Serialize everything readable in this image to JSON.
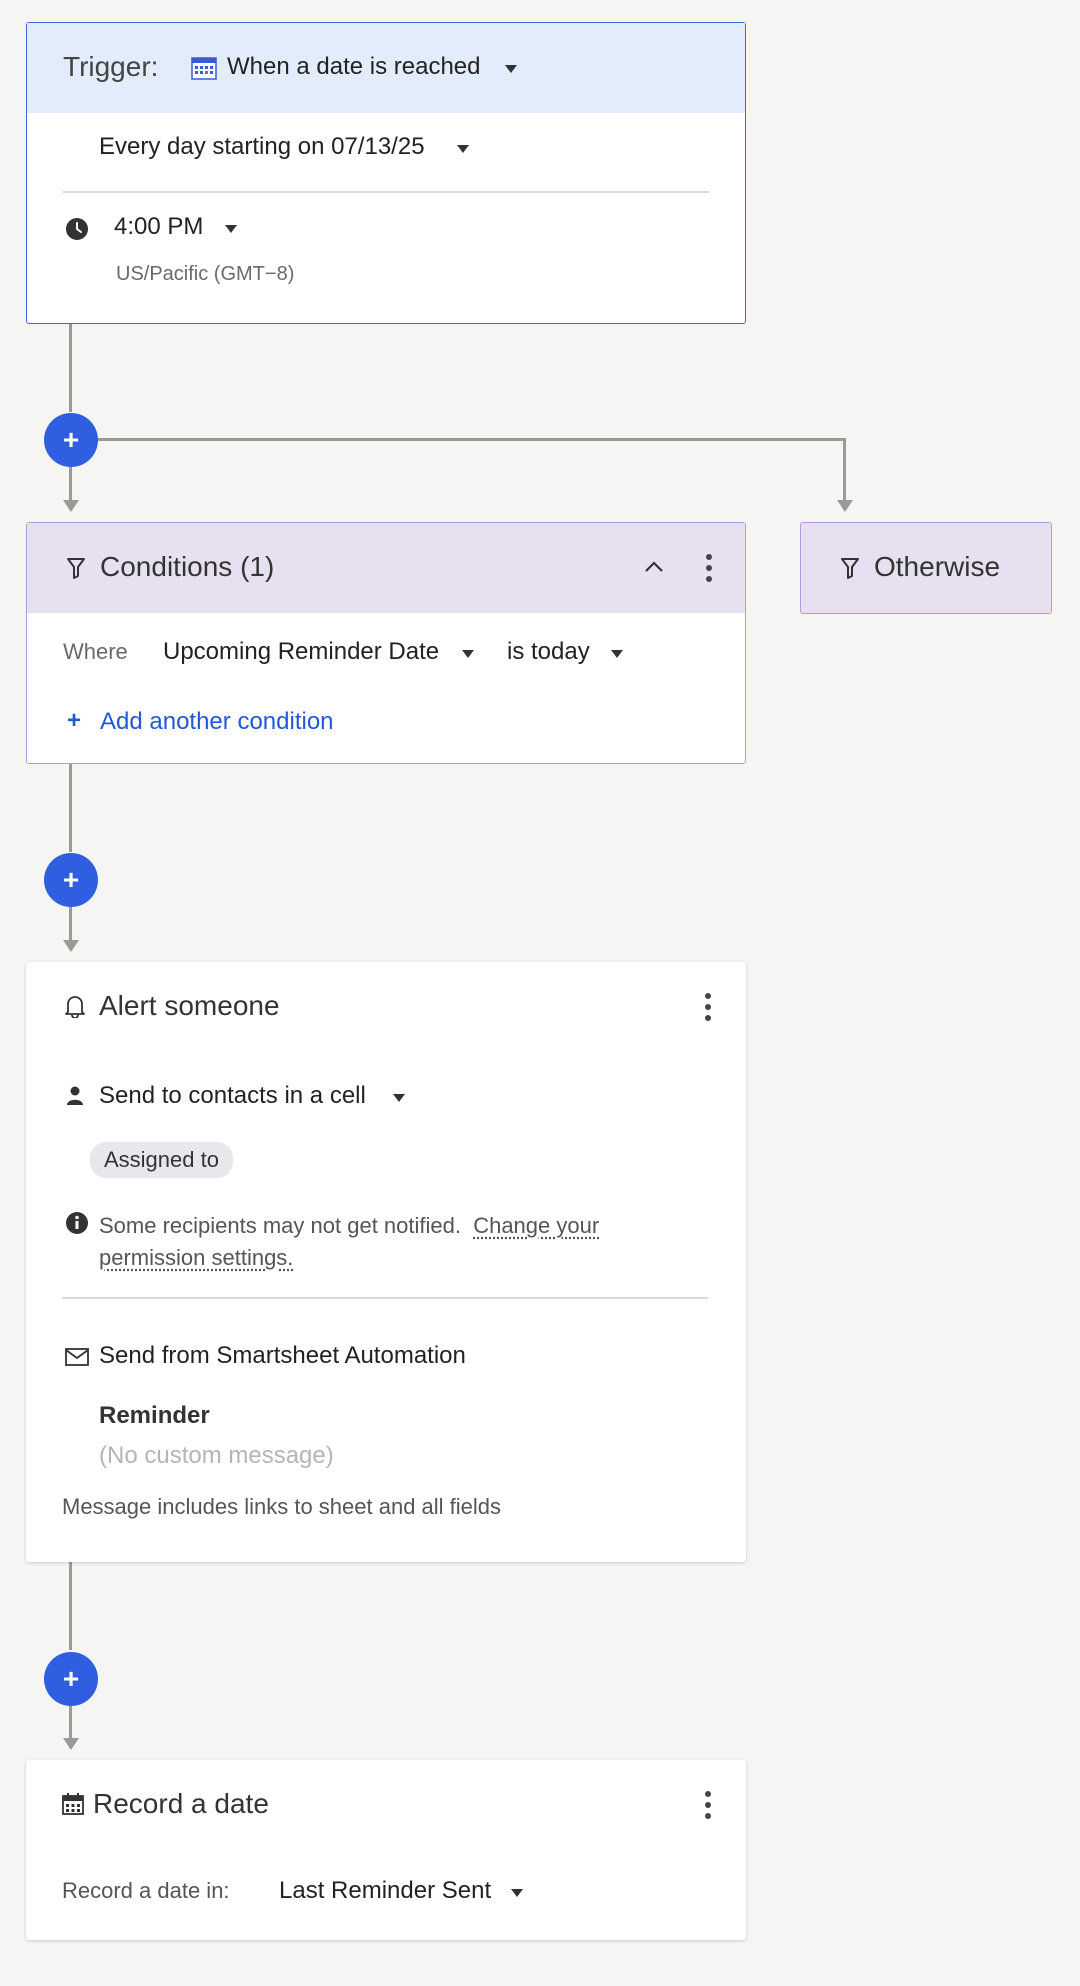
{
  "trigger": {
    "label": "Trigger:",
    "type": "When a date is reached",
    "frequency": "Every day starting on 07/13/25",
    "time": "4:00 PM",
    "timezone": "US/Pacific (GMT−8)"
  },
  "conditions": {
    "title": "Conditions (1)",
    "where_label": "Where",
    "field": "Upcoming Reminder Date",
    "operator": "is today",
    "add_label": "Add another condition"
  },
  "otherwise": {
    "label": "Otherwise"
  },
  "alert": {
    "title": "Alert someone",
    "send_to": "Send to contacts in a cell",
    "chip": "Assigned to",
    "warning_text": "Some recipients may not get notified.",
    "warning_link_1": "Change your",
    "warning_link_2": "permission settings.",
    "send_from": "Send from Smartsheet Automation",
    "subject": "Reminder",
    "message_placeholder": "(No custom message)",
    "includes": "Message includes links to sheet and all fields"
  },
  "record": {
    "title": "Record a date",
    "label": "Record a date in:",
    "column": "Last Reminder Sent"
  },
  "plus_symbol": "+",
  "colors": {
    "accent_blue": "#2f5fe0",
    "trigger_header": "#e3ecfb",
    "condition_header": "#e7e0f0",
    "link_blue": "#2258d6"
  }
}
